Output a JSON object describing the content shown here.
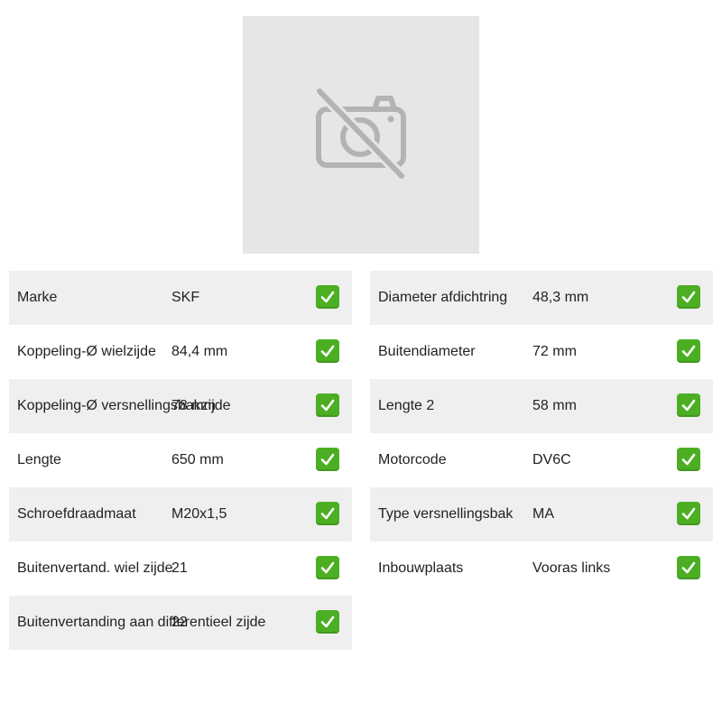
{
  "image": {
    "icon": "camera-off-icon"
  },
  "colors": {
    "row_shade": "#efefef",
    "check": "#4caf23",
    "placeholder_bg": "#e6e6e6",
    "placeholder_icon": "#b3b3b3"
  },
  "specs_left": [
    {
      "label": "Marke",
      "value": "SKF"
    },
    {
      "label": "Koppeling-Ø wielzijde",
      "value": "84,4 mm"
    },
    {
      "label": "Koppeling-Ø versnellingsbakzijde",
      "value": "78 mm"
    },
    {
      "label": "Lengte",
      "value": "650 mm"
    },
    {
      "label": "Schroefdraadmaat",
      "value": "M20x1,5"
    },
    {
      "label": "Buitenvertand. wiel zijde",
      "value": "21"
    },
    {
      "label": "Buitenvertanding aan differentieel zijde",
      "value": "22"
    }
  ],
  "specs_right": [
    {
      "label": "Diameter afdichtring",
      "value": "48,3 mm"
    },
    {
      "label": "Buitendiameter",
      "value": "72 mm"
    },
    {
      "label": "Lengte 2",
      "value": "58 mm"
    },
    {
      "label": "Motorcode",
      "value": "DV6C"
    },
    {
      "label": "Type versnellingsbak",
      "value": "MA"
    },
    {
      "label": "Inbouwplaats",
      "value": "Vooras links"
    }
  ]
}
